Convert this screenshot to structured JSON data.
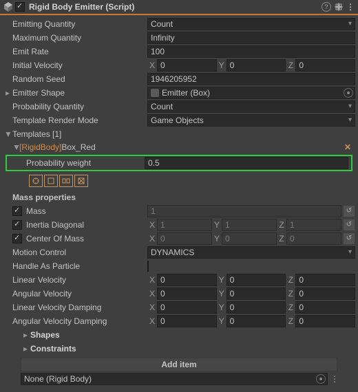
{
  "header": {
    "title": "Rigid Body Emitter (Script)"
  },
  "props": {
    "emitting_quantity_label": "Emitting Quantity",
    "emitting_quantity_value": "Count",
    "maximum_quantity_label": "Maximum Quantity",
    "maximum_quantity_value": "Infinity",
    "emit_rate_label": "Emit Rate",
    "emit_rate_value": "100",
    "initial_velocity_label": "Initial Velocity",
    "initial_velocity_x": "0",
    "initial_velocity_y": "0",
    "initial_velocity_z": "0",
    "random_seed_label": "Random Seed",
    "random_seed_value": "1946205952",
    "emitter_shape_label": "Emitter Shape",
    "emitter_shape_value": "Emitter (Box)",
    "probability_quantity_label": "Probability Quantity",
    "probability_quantity_value": "Count",
    "template_render_mode_label": "Template Render Mode",
    "template_render_mode_value": "Game Objects",
    "templates_label": "Templates [1]"
  },
  "template": {
    "prefix": "[RigidBody]",
    "name": " Box_Red",
    "probability_weight_label": "Probability weight",
    "probability_weight_value": "0.5",
    "mass_properties_label": "Mass properties",
    "mass_label": "Mass",
    "mass_value": "1",
    "inertia_label": "Inertia Diagonal",
    "inertia_x": "1",
    "inertia_y": "1",
    "inertia_z": "1",
    "com_label": "Center Of Mass",
    "com_x": "0",
    "com_y": "0",
    "com_z": "0",
    "motion_control_label": "Motion Control",
    "motion_control_value": "DYNAMICS",
    "handle_as_particle_label": "Handle As Particle",
    "linear_velocity_label": "Linear Velocity",
    "lv_x": "0",
    "lv_y": "0",
    "lv_z": "0",
    "angular_velocity_label": "Angular Velocity",
    "av_x": "0",
    "av_y": "0",
    "av_z": "0",
    "lvd_label": "Linear Velocity Damping",
    "lvd_x": "0",
    "lvd_y": "0",
    "lvd_z": "0",
    "avd_label": "Angular Velocity Damping",
    "avd_x": "0",
    "avd_y": "0",
    "avd_z": "0",
    "shapes_label": "Shapes",
    "constraints_label": "Constraints"
  },
  "footer": {
    "add_item_label": "Add item",
    "rigid_body_ref": "None (Rigid Body)"
  },
  "axis": {
    "x": "X",
    "y": "Y",
    "z": "Z"
  }
}
